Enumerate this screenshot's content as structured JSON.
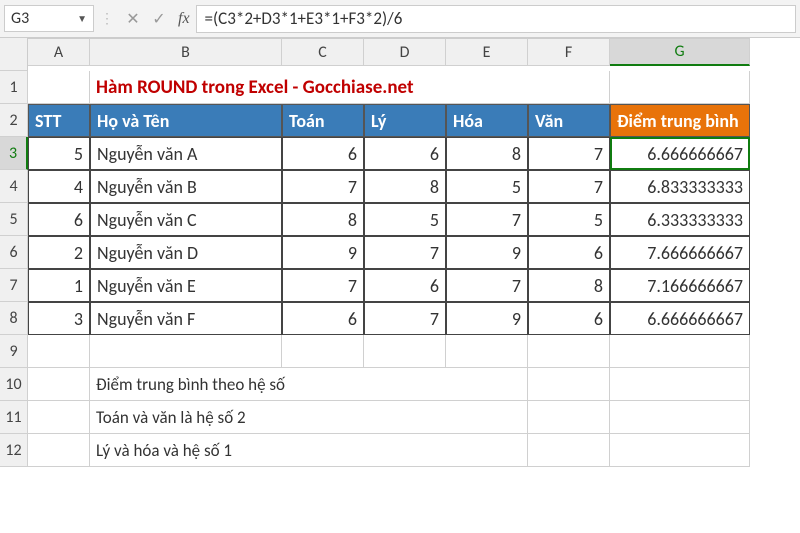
{
  "nameBox": "G3",
  "formula": "=(C3*2+D3*1+E3*1+F3*2)/6",
  "columns": [
    "A",
    "B",
    "C",
    "D",
    "E",
    "F",
    "G"
  ],
  "activeCol": "G",
  "activeRow": 3,
  "row1": {
    "title": "Hàm ROUND trong Excel  - Gocchiase.net"
  },
  "row2": {
    "stt": "STT",
    "name": "Họ và Tên",
    "toan": "Toán",
    "ly": "Lý",
    "hoa": "Hóa",
    "van": "Văn",
    "avg": "Điểm trung bình"
  },
  "data": [
    {
      "stt": "5",
      "name": "Nguyễn văn A",
      "toan": "6",
      "ly": "6",
      "hoa": "8",
      "van": "7",
      "avg": "6.666666667"
    },
    {
      "stt": "4",
      "name": "Nguyễn văn B",
      "toan": "7",
      "ly": "8",
      "hoa": "5",
      "van": "7",
      "avg": "6.833333333"
    },
    {
      "stt": "6",
      "name": "Nguyễn văn C",
      "toan": "8",
      "ly": "5",
      "hoa": "7",
      "van": "5",
      "avg": "6.333333333"
    },
    {
      "stt": "2",
      "name": "Nguyễn văn D",
      "toan": "9",
      "ly": "7",
      "hoa": "9",
      "van": "6",
      "avg": "7.666666667"
    },
    {
      "stt": "1",
      "name": "Nguyễn văn E",
      "toan": "7",
      "ly": "6",
      "hoa": "7",
      "van": "8",
      "avg": "7.166666667"
    },
    {
      "stt": "3",
      "name": "Nguyễn văn F",
      "toan": "6",
      "ly": "7",
      "hoa": "9",
      "van": "6",
      "avg": "6.666666667"
    }
  ],
  "notes": {
    "r10": "Điểm trung bình theo hệ số",
    "r11": "Toán và văn là hệ số 2",
    "r12": "Lý và hóa và hệ số 1"
  }
}
